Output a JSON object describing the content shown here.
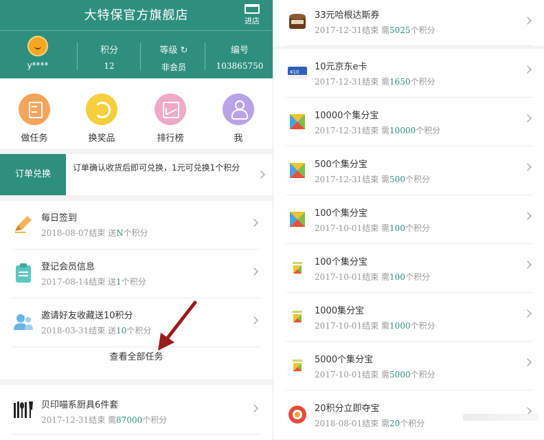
{
  "left": {
    "header": {
      "title": "大特保官方旗舰店",
      "enter_label": "进店",
      "username": "y****",
      "stats": [
        {
          "label": "积分",
          "value": "12"
        },
        {
          "label": "等级",
          "value": "非会员"
        },
        {
          "label": "编号",
          "value": "103865750"
        }
      ]
    },
    "menu": [
      {
        "label": "做任务",
        "icon": "task-doc-icon",
        "color": "#f5a55a"
      },
      {
        "label": "换奖品",
        "icon": "exchange-icon",
        "color": "#f7cf3e"
      },
      {
        "label": "排行榜",
        "icon": "chart-icon",
        "color": "#f0a9c8"
      },
      {
        "label": "我",
        "icon": "user-icon",
        "color": "#b9a3e6"
      }
    ],
    "order": {
      "tag": "订单兑换",
      "desc": "订单确认收货后即可兑换，1元可兑换1个积分"
    },
    "tasks": [
      {
        "title": "每日签到",
        "date": "2018-08-07结束",
        "prefix": "送",
        "points": "N",
        "suffix": "个积分",
        "icon": "pencil-icon"
      },
      {
        "title": "登记会员信息",
        "date": "2017-08-14结束",
        "prefix": "送",
        "points": "1",
        "suffix": "个积分",
        "icon": "clipboard-icon"
      },
      {
        "title": "邀请好友收藏送10积分",
        "date": "2018-03-31结束",
        "prefix": "送",
        "points": "10",
        "suffix": "个积分",
        "icon": "friends-icon"
      }
    ],
    "view_all": "查看全部任务",
    "shop_item": {
      "title": "贝印喵系厨具6件套",
      "date": "2017-12-31结束",
      "prefix": "需",
      "points": "87000",
      "suffix": "个积分",
      "icon": "kitchen-tools-icon"
    }
  },
  "right": {
    "items": [
      {
        "title": "33元哈根达斯券",
        "date": "2017-12-31结束",
        "prefix": "需",
        "points": "5025",
        "suffix": "个积分",
        "icon": "icecream-icon"
      },
      {
        "title": "10元京东e卡",
        "date": "2017-12-31结束",
        "prefix": "需",
        "points": "1650",
        "suffix": "个积分",
        "icon": "jd-card-icon"
      },
      {
        "title": "10000个集分宝",
        "date": "2017-12-31结束",
        "prefix": "需",
        "points": "10000",
        "suffix": "个积分",
        "icon": "jifenbao-icon"
      },
      {
        "title": "500个集分宝",
        "date": "2017-12-31结束",
        "prefix": "需",
        "points": "500",
        "suffix": "个积分",
        "icon": "jifenbao-icon"
      },
      {
        "title": "100个集分宝",
        "date": "2017-10-01结束",
        "prefix": "需",
        "points": "100",
        "suffix": "个积分",
        "icon": "jifenbao-icon"
      },
      {
        "title": "100个集分宝",
        "date": "2017-10-01结束",
        "prefix": "需",
        "points": "100",
        "suffix": "个积分",
        "icon": "jifenbao-small-icon"
      },
      {
        "title": "1000集分宝",
        "date": "2017-10-01结束",
        "prefix": "需",
        "points": "1000",
        "suffix": "个积分",
        "icon": "jifenbao-small-icon"
      },
      {
        "title": "5000个集分宝",
        "date": "2017-10-01结束",
        "prefix": "需",
        "points": "5000",
        "suffix": "个积分",
        "icon": "jifenbao-small-icon"
      },
      {
        "title": "20积分立即夺宝",
        "date": "2018-08-01结束",
        "prefix": "需",
        "points": "20",
        "suffix": "个积分",
        "icon": "lucky-draw-icon"
      }
    ]
  },
  "colors": {
    "brand": "#2e8f7e",
    "arrow": "#9b1c1c"
  }
}
